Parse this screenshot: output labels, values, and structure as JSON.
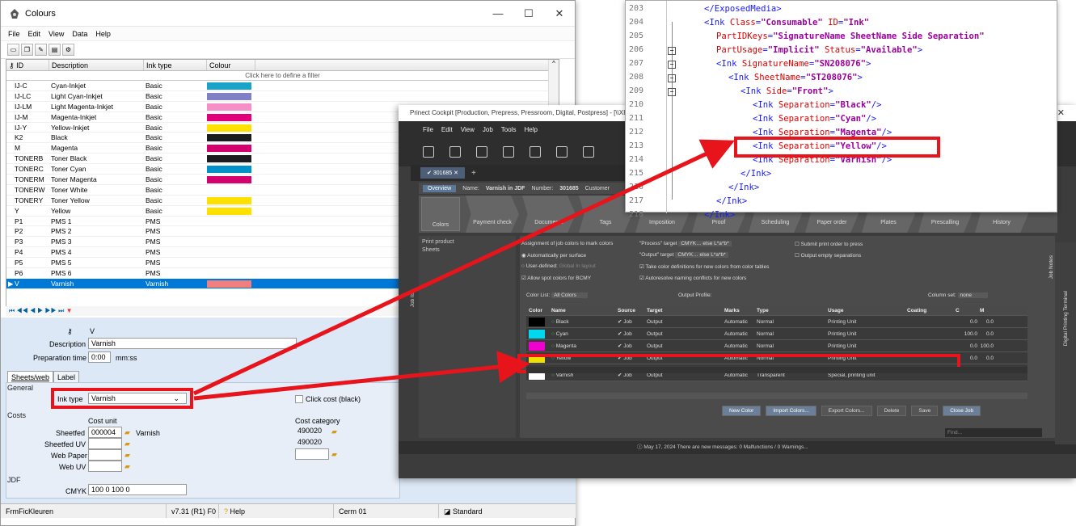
{
  "colours_window": {
    "title": "Colours",
    "window_controls": {
      "min": "—",
      "max": "☐",
      "close": "✕"
    },
    "menu": [
      "File",
      "Edit",
      "View",
      "Data",
      "Help"
    ],
    "grid": {
      "headers": [
        "ID",
        "Description",
        "Ink type",
        "Colour"
      ],
      "filter_placeholder": "Click here to define a filter",
      "rows": [
        {
          "id": "IJ-C",
          "desc": "Cyan-Inkjet",
          "type": "Basic",
          "color": "#1aa3c8"
        },
        {
          "id": "IJ-LC",
          "desc": "Light Cyan-Inkjet",
          "type": "Basic",
          "color": "#7f80c8"
        },
        {
          "id": "IJ-LM",
          "desc": "Light Magenta-Inkjet",
          "type": "Basic",
          "color": "#f58fc8"
        },
        {
          "id": "IJ-M",
          "desc": "Magenta-Inkjet",
          "type": "Basic",
          "color": "#e2007a"
        },
        {
          "id": "IJ-Y",
          "desc": "Yellow-Inkjet",
          "type": "Basic",
          "color": "#ffe100"
        },
        {
          "id": "K2",
          "desc": "Black",
          "type": "Basic",
          "color": "#1c1c1c"
        },
        {
          "id": "M",
          "desc": "Magenta",
          "type": "Basic",
          "color": "#d4006e"
        },
        {
          "id": "TONERB",
          "desc": "Toner Black",
          "type": "Basic",
          "color": "#1c1c1c"
        },
        {
          "id": "TONERC",
          "desc": "Toner Cyan",
          "type": "Basic",
          "color": "#0092c8"
        },
        {
          "id": "TONERM",
          "desc": "Toner Magenta",
          "type": "Basic",
          "color": "#d4006e"
        },
        {
          "id": "TONERW",
          "desc": "Toner White",
          "type": "Basic",
          "color": ""
        },
        {
          "id": "TONERY",
          "desc": "Toner Yellow",
          "type": "Basic",
          "color": "#ffe100"
        },
        {
          "id": "Y",
          "desc": "Yellow",
          "type": "Basic",
          "color": "#ffe100"
        },
        {
          "id": "P1",
          "desc": "PMS 1",
          "type": "PMS",
          "color": ""
        },
        {
          "id": "P2",
          "desc": "PMS 2",
          "type": "PMS",
          "color": ""
        },
        {
          "id": "P3",
          "desc": "PMS 3",
          "type": "PMS",
          "color": ""
        },
        {
          "id": "P4",
          "desc": "PMS 4",
          "type": "PMS",
          "color": ""
        },
        {
          "id": "P5",
          "desc": "PMS 5",
          "type": "PMS",
          "color": ""
        },
        {
          "id": "P6",
          "desc": "PMS 6",
          "type": "PMS",
          "color": ""
        },
        {
          "id": "V",
          "desc": "Varnish",
          "type": "Varnish",
          "color": "#f08080",
          "selected": true
        }
      ]
    },
    "detail": {
      "id_value": "V",
      "description_label": "Description",
      "description_value": "Varnish",
      "prep_label": "Preparation time",
      "prep_value": "0:00",
      "prep_unit": "mm:ss",
      "tabs": [
        "Sheets/web",
        "Label"
      ],
      "general_label": "General",
      "inktype_label": "Ink type",
      "inktype_value": "Varnish",
      "clickcost_label": "Click cost (black)",
      "costs_label": "Costs",
      "costunit_label": "Cost unit",
      "costcat_label": "Cost category",
      "sheetfed_label": "Sheetfed",
      "sheetfed_value": "000004",
      "sheetfed_name": "Varnish",
      "sheetfed_cat": "490020",
      "sheetfeduv_label": "Sheetfed UV",
      "sheetfeduv_cat": "490020",
      "webpaper_label": "Web Paper",
      "webuv_label": "Web UV",
      "jdf_label": "JDF",
      "cmyk_label": "CMYK",
      "cmyk_value": "100 0 100 0"
    },
    "status": [
      "FrmFicKleuren",
      "v7.31 (R1) F0",
      "Help",
      "Cerm 01",
      "Standard"
    ]
  },
  "cockpit_window": {
    "title": "Prinect Cockpit [Production, Prepress, Pressroom, Digital, Postpress] - [\\\\XIE-HEIPC4#",
    "menu": [
      "File",
      "Edit",
      "View",
      "Job",
      "Tools",
      "Help"
    ],
    "job_tab": "301685",
    "info": {
      "overview": "Overview",
      "name_label": "Name:",
      "name": "Varnish in JDF",
      "number_label": "Number:",
      "number": "301685",
      "customer_label": "Customer"
    },
    "steps": [
      "Payment check",
      "Documents",
      "Tags",
      "Imposition",
      "Proof",
      "Scheduling",
      "Paper order",
      "Plates",
      "Prescalling",
      "History"
    ],
    "colors_btn": "Colors",
    "side": [
      "Print product",
      "Sheets"
    ],
    "options": {
      "assignment": "Assignment of job colors to mark colors",
      "auto": "Automatically per surface",
      "user": "User-defined:",
      "global": "Global",
      "layout": "In layout",
      "spot": "Allow spot colors for BCMY",
      "process_target": "\"Process\" target",
      "process_val": "CMYK… else L*a*b*",
      "output_target": "\"Output\" target",
      "output_val": "CMYK… else L*a*b*",
      "take_def": "Take color definitions for new colors from color tables",
      "autoresolve": "Autoresolve naming conflicts for new colors",
      "submit": "Submit print order to press",
      "output_empty": "Output empty separations",
      "color_list_label": "Color List:",
      "color_list_val": "All Colors",
      "output_profile": "Output Profile:",
      "column_set": "Column set:",
      "column_set_val": "none"
    },
    "table": {
      "headers": [
        "Color",
        "Name",
        "Source",
        "Target",
        "Marks",
        "Type",
        "Usage",
        "Coating",
        "C",
        "M"
      ],
      "rows": [
        {
          "swatch": "#000000",
          "name": "Black",
          "source": "Job",
          "target": "Output",
          "marks": "Automatic",
          "type": "Normal",
          "usage": "Printing Unit",
          "c": "0.0",
          "m": "0.0"
        },
        {
          "swatch": "#00d8f0",
          "name": "Cyan",
          "source": "Job",
          "target": "Output",
          "marks": "Automatic",
          "type": "Normal",
          "usage": "Printing Unit",
          "c": "100.0",
          "m": "0.0"
        },
        {
          "swatch": "#f000d0",
          "name": "Magenta",
          "source": "Job",
          "target": "Output",
          "marks": "Automatic",
          "type": "Normal",
          "usage": "Printing Unit",
          "c": "0.0",
          "m": "100.0"
        },
        {
          "swatch": "#f0e000",
          "name": "Yellow",
          "source": "Job",
          "target": "Output",
          "marks": "Automatic",
          "type": "Normal",
          "usage": "Printing Unit",
          "c": "0.0",
          "m": "0.0"
        },
        {
          "swatch": "#ffffff",
          "name": "Varnish",
          "source": "Job",
          "target": "Output",
          "marks": "Automatic",
          "type": "Transparent",
          "usage": "Special, printing unit",
          "c": "",
          "m": ""
        }
      ]
    },
    "buttons": [
      "New Color",
      "Import Colors...",
      "Export Colors...",
      "Delete",
      "Save",
      "Close Job"
    ],
    "find_placeholder": "Find...",
    "status_text": "May 17, 2024  There are new messages: 0 Malfunctions / 0 Warnings...",
    "right_tabs": [
      "Job Notes",
      "Digital Printing Terminal"
    ],
    "left_tab": "Job list"
  },
  "xml_panel": {
    "lines": [
      {
        "n": "203",
        "parts": [
          [
            "tg",
            "</ExposedMedia>"
          ]
        ],
        "indent": 0
      },
      {
        "n": "204",
        "parts": [
          [
            "tg",
            "<Ink "
          ],
          [
            "at",
            "Class"
          ],
          [
            "tg",
            "="
          ],
          [
            "vl",
            "\"Consumable\""
          ],
          [
            "tg",
            " "
          ],
          [
            "at",
            "ID"
          ],
          [
            "tg",
            "="
          ],
          [
            "vl",
            "\"Ink\""
          ]
        ],
        "indent": 0
      },
      {
        "n": "205",
        "parts": [
          [
            "at",
            "PartIDKeys"
          ],
          [
            "tg",
            "="
          ],
          [
            "vl",
            "\"SignatureName SheetName Side Separation\""
          ]
        ],
        "indent": 1
      },
      {
        "n": "206",
        "parts": [
          [
            "at",
            "PartUsage"
          ],
          [
            "tg",
            "="
          ],
          [
            "vl",
            "\"Implicit\""
          ],
          [
            "tg",
            " "
          ],
          [
            "at",
            "Status"
          ],
          [
            "tg",
            "="
          ],
          [
            "vl",
            "\"Available\""
          ],
          [
            "tg",
            ">"
          ]
        ],
        "indent": 1
      },
      {
        "n": "207",
        "parts": [
          [
            "tg",
            "<Ink "
          ],
          [
            "at",
            "SignatureName"
          ],
          [
            "tg",
            "="
          ],
          [
            "vl",
            "\"SN208076\""
          ],
          [
            "tg",
            ">"
          ]
        ],
        "indent": 1
      },
      {
        "n": "208",
        "parts": [
          [
            "tg",
            "<Ink "
          ],
          [
            "at",
            "SheetName"
          ],
          [
            "tg",
            "="
          ],
          [
            "vl",
            "\"ST208076\""
          ],
          [
            "tg",
            ">"
          ]
        ],
        "indent": 2
      },
      {
        "n": "209",
        "parts": [
          [
            "tg",
            "<Ink "
          ],
          [
            "at",
            "Side"
          ],
          [
            "tg",
            "="
          ],
          [
            "vl",
            "\"Front\""
          ],
          [
            "tg",
            ">"
          ]
        ],
        "indent": 3
      },
      {
        "n": "210",
        "parts": [
          [
            "tg",
            "<Ink "
          ],
          [
            "at",
            "Separation"
          ],
          [
            "tg",
            "="
          ],
          [
            "vl",
            "\"Black\""
          ],
          [
            "tg",
            "/>"
          ]
        ],
        "indent": 4
      },
      {
        "n": "211",
        "parts": [
          [
            "tg",
            "<Ink "
          ],
          [
            "at",
            "Separation"
          ],
          [
            "tg",
            "="
          ],
          [
            "vl",
            "\"Cyan\""
          ],
          [
            "tg",
            "/>"
          ]
        ],
        "indent": 4
      },
      {
        "n": "212",
        "parts": [
          [
            "tg",
            "<Ink "
          ],
          [
            "at",
            "Separation"
          ],
          [
            "tg",
            "="
          ],
          [
            "vl",
            "\"Magenta\""
          ],
          [
            "tg",
            "/>"
          ]
        ],
        "indent": 4
      },
      {
        "n": "213",
        "parts": [
          [
            "tg",
            "<Ink "
          ],
          [
            "at",
            "Separation"
          ],
          [
            "tg",
            "="
          ],
          [
            "vl",
            "\"Yellow\""
          ],
          [
            "tg",
            "/>"
          ]
        ],
        "indent": 4
      },
      {
        "n": "214",
        "parts": [
          [
            "tg",
            "<Ink "
          ],
          [
            "at",
            "Separation"
          ],
          [
            "tg",
            "="
          ],
          [
            "vl",
            "\"Varnish\""
          ],
          [
            "tg",
            "/>"
          ]
        ],
        "indent": 4
      },
      {
        "n": "215",
        "parts": [
          [
            "tg",
            "</Ink>"
          ]
        ],
        "indent": 3
      },
      {
        "n": "216",
        "parts": [
          [
            "tg",
            "</Ink>"
          ]
        ],
        "indent": 2
      },
      {
        "n": "217",
        "parts": [
          [
            "tg",
            "</Ink>"
          ]
        ],
        "indent": 1
      },
      {
        "n": "218",
        "parts": [
          [
            "tg",
            "</Ink>"
          ]
        ],
        "indent": 0
      }
    ]
  }
}
